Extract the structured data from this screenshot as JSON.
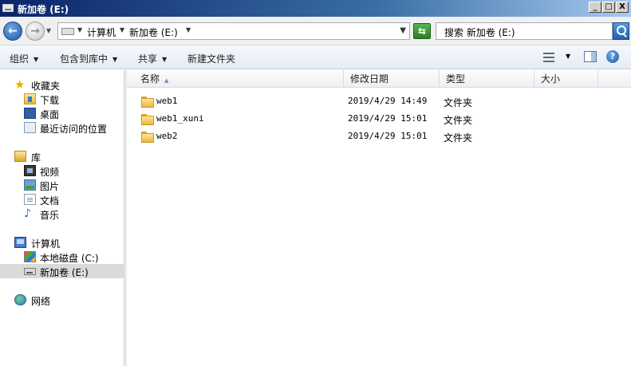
{
  "window": {
    "title": "新加卷 (E:)",
    "minimize": "_",
    "maximize": "□",
    "close": "X"
  },
  "address": {
    "crumbs": [
      "计算机",
      "新加卷 (E:)"
    ],
    "search_placeholder": "搜索 新加卷 (E:)"
  },
  "toolbar": {
    "organize": "组织",
    "include_in_library": "包含到库中",
    "share": "共享",
    "new_folder": "新建文件夹"
  },
  "nav": {
    "favorites": "收藏夹",
    "downloads": "下载",
    "desktop": "桌面",
    "recent": "最近访问的位置",
    "libraries": "库",
    "videos": "视频",
    "pictures": "图片",
    "documents": "文档",
    "music": "音乐",
    "computer": "计算机",
    "local_disk": "本地磁盘 (C:)",
    "new_volume": "新加卷 (E:)",
    "network": "网络"
  },
  "columns": {
    "name": "名称",
    "modified": "修改日期",
    "type": "类型",
    "size": "大小"
  },
  "files": [
    {
      "name": "web1",
      "modified": "2019/4/29 14:49",
      "type": "文件夹"
    },
    {
      "name": "web1_xuni",
      "modified": "2019/4/29 15:01",
      "type": "文件夹"
    },
    {
      "name": "web2",
      "modified": "2019/4/29 15:01",
      "type": "文件夹"
    }
  ],
  "colors": {
    "title_bar_start": "#0a246a",
    "selected_nav": "#dadada",
    "folder": "#e8b83a"
  }
}
